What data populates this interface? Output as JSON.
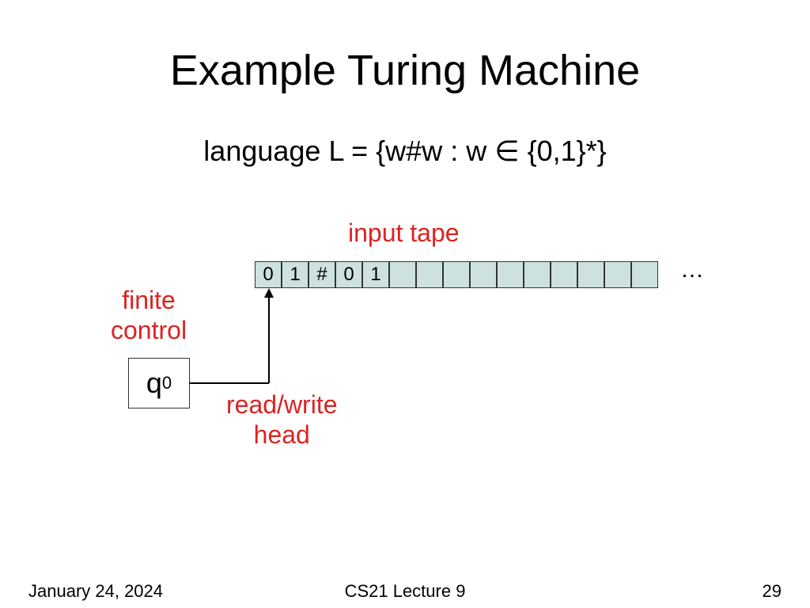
{
  "title": "Example Turing Machine",
  "language": "language L = {w#w : w ∈ {0,1}*}",
  "labels": {
    "input_tape": "input tape",
    "finite_control_l1": "finite",
    "finite_control_l2": "control",
    "rw_head_l1": "read/write",
    "rw_head_l2": "head",
    "dots": "…"
  },
  "state": {
    "name": "q",
    "sub": "0"
  },
  "tape": [
    "0",
    "1",
    "#",
    "0",
    "1",
    "",
    "",
    "",
    "",
    "",
    "",
    "",
    "",
    "",
    ""
  ],
  "footer": {
    "date": "January 24, 2024",
    "center": "CS21 Lecture 9",
    "page": "29"
  }
}
